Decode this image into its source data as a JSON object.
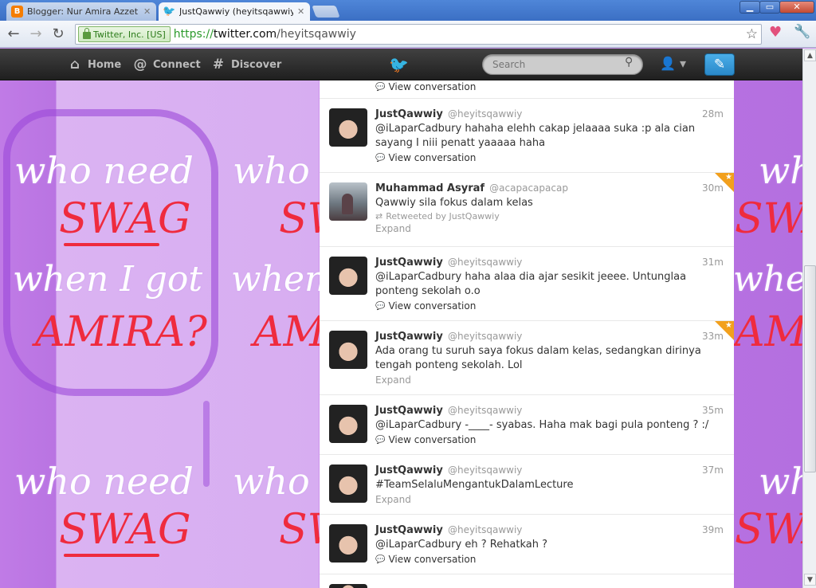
{
  "browser": {
    "tabs": [
      {
        "title": "Blogger: Nur Amira Azzet Offi",
        "icon": "blogger-icon",
        "active": false
      },
      {
        "title": "JustQawwiy (heyitsqawwiy) c",
        "icon": "twitter-bird-icon",
        "active": true
      }
    ],
    "window_buttons": {
      "minimize": "▁",
      "maximize": "▭",
      "close": "✕"
    },
    "ev_badge": "Twitter, Inc. [US]",
    "url_scheme": "https://",
    "url_host": "twitter.com",
    "url_path": "/heyitsqawwiy"
  },
  "twitter_nav": {
    "home": "Home",
    "connect": "Connect",
    "discover": "Discover",
    "search_placeholder": "Search"
  },
  "background_art": {
    "line1": "who need",
    "line2": "SWAG",
    "line3": "when I got",
    "line4": "AMIRA?"
  },
  "tweets": [
    {
      "fullname": "",
      "username": "",
      "time": "",
      "text": "",
      "action": "View conversation",
      "partial": true
    },
    {
      "fullname": "JustQawwiy",
      "username": "@heyitsqawwiy",
      "time": "28m",
      "text": "@iLaparCadbury hahaha elehh cakap jelaaaa suka :p ala cian sayang I niii penatt yaaaaa haha",
      "action": "View conversation"
    },
    {
      "fullname": "Muhammad Asyraf",
      "username": "@acapacapacap",
      "time": "30m",
      "text": "Qawwiy sila fokus dalam kelas",
      "retweeted": "Retweeted by JustQawwiy",
      "action": "Expand",
      "favorited": true
    },
    {
      "fullname": "JustQawwiy",
      "username": "@heyitsqawwiy",
      "time": "31m",
      "text": "@iLaparCadbury haha alaa dia ajar sesikit jeeee. Untunglaa ponteng sekolah o.o",
      "action": "View conversation"
    },
    {
      "fullname": "JustQawwiy",
      "username": "@heyitsqawwiy",
      "time": "33m",
      "text": "Ada orang tu suruh saya fokus dalam kelas, sedangkan dirinya tengah ponteng sekolah. Lol",
      "action": "Expand",
      "favorited": true
    },
    {
      "fullname": "JustQawwiy",
      "username": "@heyitsqawwiy",
      "time": "35m",
      "text": "@iLaparCadbury -____- syabas. Haha mak bagi pula ponteng ? :/",
      "action": "View conversation"
    },
    {
      "fullname": "JustQawwiy",
      "username": "@heyitsqawwiy",
      "time": "37m",
      "text": "#TeamSelaluMengantukDalamLecture",
      "action": "Expand"
    },
    {
      "fullname": "JustQawwiy",
      "username": "@heyitsqawwiy",
      "time": "39m",
      "text": "@iLaparCadbury eh ? Rehatkah ?",
      "action": "View conversation"
    }
  ],
  "colors": {
    "accent": "#2a88c9",
    "favorite": "#f2a01d",
    "bar": "#2a2a2a"
  }
}
